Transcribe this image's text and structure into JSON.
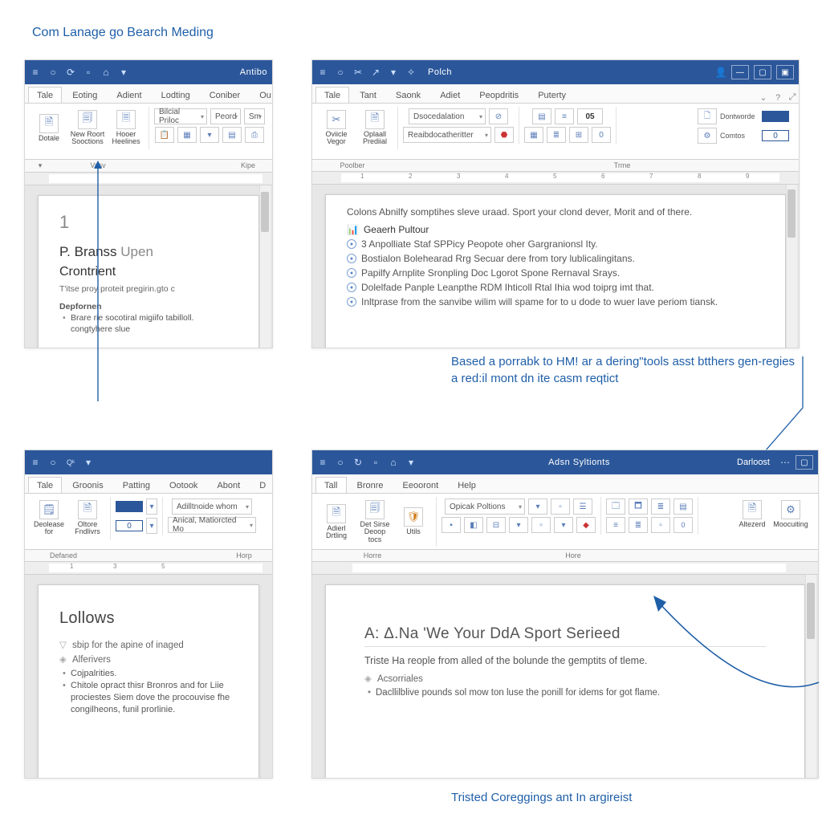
{
  "page": {
    "title": "Com Lanage go Bearch Meding",
    "caption_mid": "Based a porrabk to HM! ar a dering\"tools asst btthers gen-regies a red:il mont dn ite casm reqtict",
    "caption_bot": "Tristed Coreggings ant In argireist"
  },
  "win1": {
    "title": "Antibo",
    "tabs": [
      "Tale",
      "Eoting",
      "Adient",
      "Lodting",
      "Coniber",
      "Ou"
    ],
    "btn1": "Dotale",
    "btn2": "New Roort Sooctions",
    "btn3": "Hooer Heelines",
    "combo1": "Bilcial Priloc",
    "combo2": "Peord",
    "combo3": "Sm",
    "glabel_left": "Vasv",
    "glabel_right": "Kipe",
    "doc": {
      "num": "1",
      "sec_pre": "P.",
      "sec_main": "Branss",
      "sec_dim": "Upen",
      "sub": "Crontrient",
      "p1": "T'itse proy proteit pregirin.gto c",
      "p2": "Depfornen",
      "b1": "Brare rie socotiral migiifo tabilloll. congtyhere slue"
    }
  },
  "win2": {
    "title": "Polch",
    "tabs": [
      "Tale",
      "Tant",
      "Saonk",
      "Adiet",
      "Peopdritis",
      "Puterty"
    ],
    "btn1": "Oviicle Vegor",
    "btn2": "Oplaall Prediial",
    "combo1": "Dsocedalation",
    "combo2": "Reaibdocatheritter",
    "num_badge": "05",
    "side1": "Dontworde",
    "side2": "Comtos",
    "side_zero": "0",
    "glabel_left": "Poolber",
    "glabel_right": "Trme",
    "doc": {
      "lead": "Colons Abnilfy somptihes sleve uraad. Sport your clond dever, Morit and of there.",
      "link_head": "Geaerh Pultour",
      "l1": "3 Anpolliate Staf SPPicy Peopote oher Gargranionsl Ity.",
      "l2": "Bostialon Bolehearad Rrg Secuar dere from tory lublicalingitans.",
      "l3": "Papilfy Arnplite Sronpling Doc Lgorot Spone Rernaval Srays.",
      "l4": "Dolelfade Panple Leanpthe RDM Ihticoll Rtal Ihia wod toiprg imt that.",
      "l5": "Inltprase from the sanvibe wilim will spame for to u dode to wuer lave periom tiansk."
    }
  },
  "win3": {
    "tabs": [
      "Tale",
      "Groonis",
      "Patting",
      "Ootook",
      "Abont",
      "D"
    ],
    "btn1": "Deolease for",
    "btn2": "Oltore Fndlivrs",
    "combo1": "Adilltnoide whom",
    "combo2": "Anical, Matiorcted Mo",
    "zero": "0",
    "glabel_left": "Defaned",
    "glabel_right": "Horp",
    "doc": {
      "title": "Lollows",
      "d1": "sbip for the apine of inaged",
      "d2": "Alferivers",
      "b1": "Cojpalrities.",
      "b2": "Chitole opract thisr Bronros and for Liie prociestes Siem dove the procouvise fhe congilheons, funil prorlinie."
    }
  },
  "win4": {
    "title": "Adsn Syltionts",
    "title_right": "Darloost",
    "tabs": [
      "Tall",
      "Bronre",
      "Eeooront",
      "Help"
    ],
    "btn1": "Adierl Drtling",
    "btn2": "Det Sirse Deoop tocs",
    "btn3": "Utils",
    "combo1": "Opicak Poltions",
    "side1": "Altezerd",
    "side2": "Moocuiting",
    "glabel_left": "Horre",
    "glabel_right": "Hore",
    "doc": {
      "title_pre": "A: Δ.Na 'We Your DdA Sport Serieed",
      "lead": "Triste Ha reople from alled of the bolunde the gemptits of tleme.",
      "d1": "Acsorriales",
      "b1": "Dacllilblive pounds sol mow ton luse the ponill for idems for got flame."
    }
  }
}
